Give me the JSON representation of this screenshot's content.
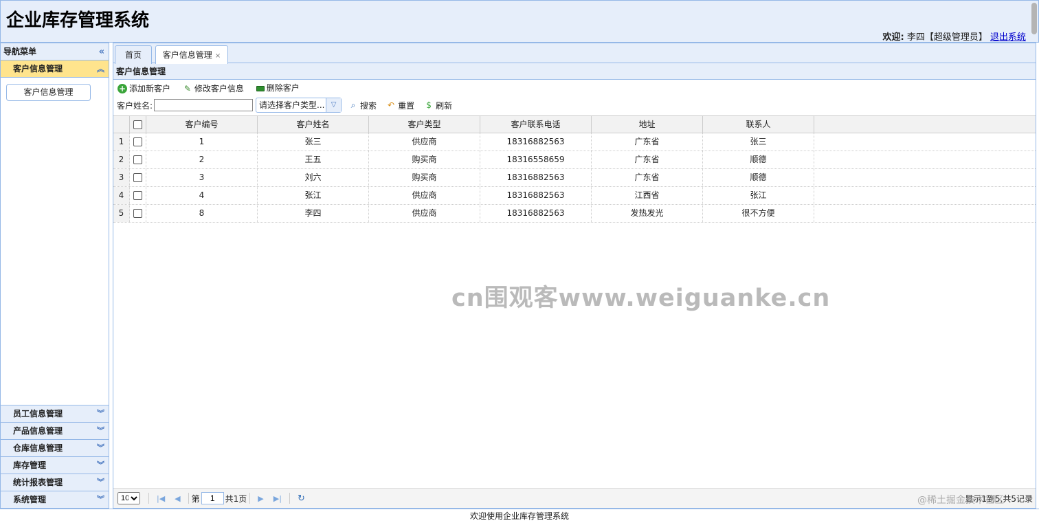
{
  "header": {
    "title": "企业库存管理系统",
    "welcome_label": "欢迎:",
    "user": "李四【超级管理员】",
    "logout": "退出系统"
  },
  "sidebar": {
    "title": "导航菜单",
    "collapse_icon": "double-chevron-left-icon",
    "active_panel": "客户信息管理",
    "active_item": "客户信息管理",
    "panels": [
      "员工信息管理",
      "产品信息管理",
      "仓库信息管理",
      "库存管理",
      "统计报表管理",
      "系统管理"
    ]
  },
  "tabs": [
    {
      "label": "首页"
    },
    {
      "label": "客户信息管理",
      "close": "×"
    }
  ],
  "panel": {
    "title": "客户信息管理",
    "buttons": {
      "add": "添加新客户",
      "edit": "修改客户信息",
      "delete": "删除客户"
    },
    "search": {
      "name_label": "客户姓名:",
      "name_value": "",
      "type_placeholder": "请选择客户类型...",
      "search": "搜索",
      "reset": "重置",
      "refresh": "刷新"
    }
  },
  "grid": {
    "columns": [
      "客户编号",
      "客户姓名",
      "客户类型",
      "客户联系电话",
      "地址",
      "联系人"
    ],
    "rows": [
      {
        "n": "1",
        "id": "1",
        "name": "张三",
        "type": "供应商",
        "phone": "18316882563",
        "addr": "广东省",
        "contact": "张三"
      },
      {
        "n": "2",
        "id": "2",
        "name": "王五",
        "type": "购买商",
        "phone": "18316558659",
        "addr": "广东省",
        "contact": "顺德"
      },
      {
        "n": "3",
        "id": "3",
        "name": "刘六",
        "type": "购买商",
        "phone": "18316882563",
        "addr": "广东省",
        "contact": "顺德"
      },
      {
        "n": "4",
        "id": "4",
        "name": "张江",
        "type": "供应商",
        "phone": "18316882563",
        "addr": "江西省",
        "contact": "张江"
      },
      {
        "n": "5",
        "id": "8",
        "name": "李四",
        "type": "供应商",
        "phone": "18316882563",
        "addr": "发热发光",
        "contact": "很不方便"
      }
    ]
  },
  "pager": {
    "page_size": "10",
    "page_prefix": "第",
    "page": "1",
    "page_total": "共1页",
    "info": "显示1到5,共5记录"
  },
  "watermark": "cn围观客www.weiguanke.cn",
  "juejin": "@稀土掘金技术社区",
  "footer": "欢迎使用企业库存管理系统"
}
